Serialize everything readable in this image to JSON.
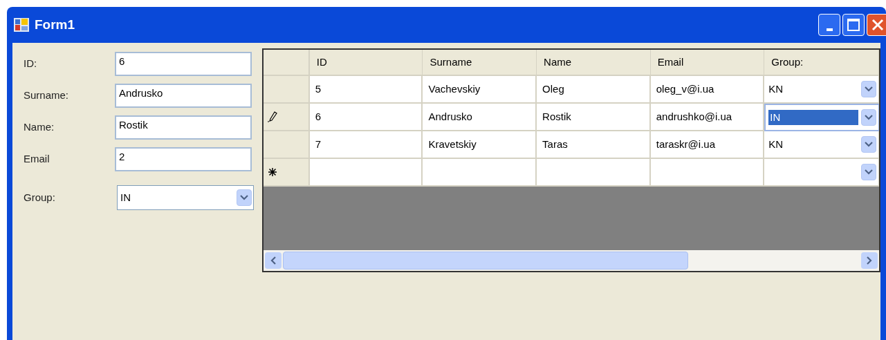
{
  "window": {
    "title": "Form1"
  },
  "form": [
    {
      "label": "ID:",
      "kind": "text",
      "value": "6"
    },
    {
      "label": "Surname:",
      "kind": "text",
      "value": "Andrusko"
    },
    {
      "label": "Name:",
      "kind": "text",
      "value": "Rostik"
    },
    {
      "label": "Email",
      "kind": "text",
      "value": "2"
    },
    {
      "label": "Group:",
      "kind": "combo",
      "value": "IN"
    }
  ],
  "table": {
    "columns": [
      "ID",
      "Surname",
      "Name",
      "Email",
      "Group:"
    ],
    "rows": [
      {
        "kind": "plain",
        "cells": [
          "5",
          "Vachevskiy",
          "Oleg",
          "oleg_v@i.ua",
          "KN"
        ],
        "group_selected": false
      },
      {
        "kind": "editing",
        "cells": [
          "6",
          "Andrusko",
          "Rostik",
          "andrushko@i.ua",
          "IN"
        ],
        "group_selected": true
      },
      {
        "kind": "plain",
        "cells": [
          "7",
          "Kravetskiy",
          "Taras",
          "taraskr@i.ua",
          "KN"
        ],
        "group_selected": false
      },
      {
        "kind": "new",
        "cells": []
      }
    ]
  }
}
